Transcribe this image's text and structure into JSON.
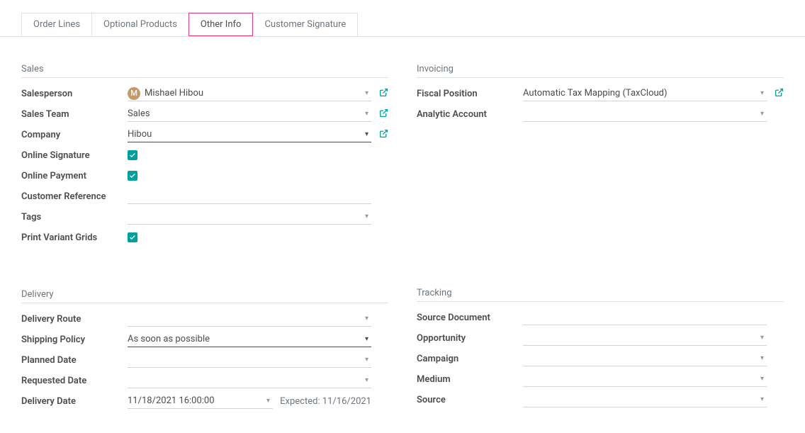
{
  "tabs": {
    "order_lines": "Order Lines",
    "optional_products": "Optional Products",
    "other_info": "Other Info",
    "customer_signature": "Customer Signature"
  },
  "sales": {
    "title": "Sales",
    "salesperson": {
      "label": "Salesperson",
      "avatar_letter": "M",
      "value": "Mishael Hibou"
    },
    "sales_team": {
      "label": "Sales Team",
      "value": "Sales"
    },
    "company": {
      "label": "Company",
      "value": "Hibou"
    },
    "online_signature": {
      "label": "Online Signature"
    },
    "online_payment": {
      "label": "Online Payment"
    },
    "customer_reference": {
      "label": "Customer Reference",
      "value": ""
    },
    "tags": {
      "label": "Tags",
      "value": ""
    },
    "print_variant_grids": {
      "label": "Print Variant Grids"
    }
  },
  "invoicing": {
    "title": "Invoicing",
    "fiscal_position": {
      "label": "Fiscal Position",
      "value": "Automatic Tax Mapping (TaxCloud)"
    },
    "analytic_account": {
      "label": "Analytic Account",
      "value": ""
    }
  },
  "delivery": {
    "title": "Delivery",
    "delivery_route": {
      "label": "Delivery Route",
      "value": ""
    },
    "shipping_policy": {
      "label": "Shipping Policy",
      "value": "As soon as possible"
    },
    "planned_date": {
      "label": "Planned Date",
      "value": ""
    },
    "requested_date": {
      "label": "Requested Date",
      "value": ""
    },
    "delivery_date": {
      "label": "Delivery Date",
      "value": "11/18/2021 16:00:00",
      "expected": "Expected: 11/16/2021"
    }
  },
  "tracking": {
    "title": "Tracking",
    "source_document": {
      "label": "Source Document",
      "value": ""
    },
    "opportunity": {
      "label": "Opportunity",
      "value": ""
    },
    "campaign": {
      "label": "Campaign",
      "value": ""
    },
    "medium": {
      "label": "Medium",
      "value": ""
    },
    "source": {
      "label": "Source",
      "value": ""
    }
  }
}
